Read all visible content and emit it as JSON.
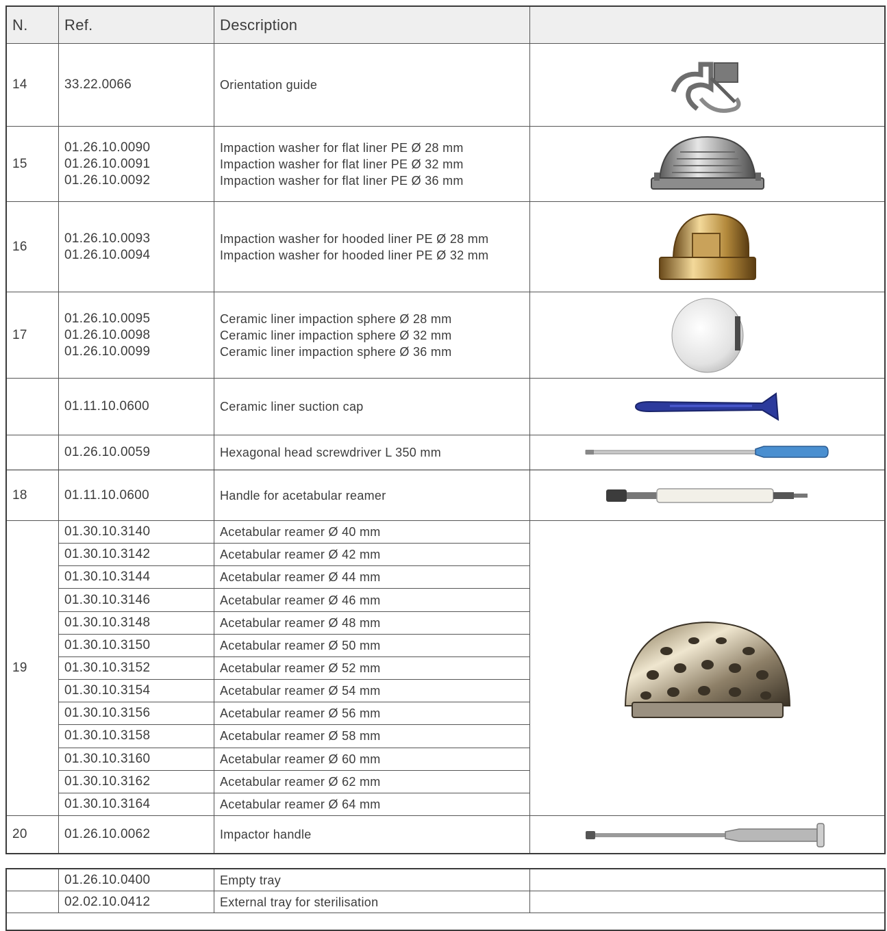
{
  "header": {
    "n": "N.",
    "ref": "Ref.",
    "description": "Description",
    "image": ""
  },
  "rows": [
    {
      "n": "14",
      "refs": [
        "33.22.0066"
      ],
      "descs": [
        "Orientation guide"
      ],
      "image": "orientation-guide-image"
    },
    {
      "n": "15",
      "refs": [
        "01.26.10.0090",
        "01.26.10.0091",
        "01.26.10.0092"
      ],
      "descs": [
        "Impaction washer for flat liner PE Ø 28 mm",
        "Impaction washer for flat liner PE Ø 32 mm",
        "Impaction washer for flat liner PE Ø 36 mm"
      ],
      "image": "flat-liner-washer-image"
    },
    {
      "n": "16",
      "refs": [
        "01.26.10.0093",
        "01.26.10.0094"
      ],
      "descs": [
        "Impaction washer for hooded liner PE Ø 28 mm",
        "Impaction washer for hooded liner PE Ø 32 mm"
      ],
      "image": "hooded-liner-washer-image"
    },
    {
      "n": "17",
      "refs": [
        "01.26.10.0095",
        "01.26.10.0098",
        "01.26.10.0099"
      ],
      "descs": [
        "Ceramic liner impaction sphere Ø 28 mm",
        "Ceramic liner impaction sphere Ø 32 mm",
        "Ceramic liner impaction sphere Ø 36 mm"
      ],
      "image": "ceramic-sphere-image"
    },
    {
      "n": "",
      "refs": [
        "01.11.10.0600"
      ],
      "descs": [
        "Ceramic liner suction cap"
      ],
      "image": "suction-cap-image"
    },
    {
      "n": "",
      "refs": [
        "01.26.10.0059"
      ],
      "descs": [
        "Hexagonal head screwdriver L 350 mm"
      ],
      "image": "screwdriver-image"
    },
    {
      "n": "18",
      "refs": [
        "01.11.10.0600"
      ],
      "descs": [
        "Handle for acetabular reamer"
      ],
      "image": "reamer-handle-image"
    }
  ],
  "reamers": {
    "n": "19",
    "image": "acetabular-reamer-image",
    "items": [
      {
        "ref": "01.30.10.3140",
        "desc": "Acetabular reamer Ø 40 mm"
      },
      {
        "ref": "01.30.10.3142",
        "desc": "Acetabular reamer Ø 42 mm"
      },
      {
        "ref": "01.30.10.3144",
        "desc": "Acetabular reamer Ø 44 mm"
      },
      {
        "ref": "01.30.10.3146",
        "desc": "Acetabular reamer Ø 46 mm"
      },
      {
        "ref": "01.30.10.3148",
        "desc": "Acetabular reamer Ø 48 mm"
      },
      {
        "ref": "01.30.10.3150",
        "desc": "Acetabular reamer Ø 50 mm"
      },
      {
        "ref": "01.30.10.3152",
        "desc": "Acetabular reamer Ø 52 mm"
      },
      {
        "ref": "01.30.10.3154",
        "desc": "Acetabular reamer Ø 54 mm"
      },
      {
        "ref": "01.30.10.3156",
        "desc": "Acetabular reamer Ø 56 mm"
      },
      {
        "ref": "01.30.10.3158",
        "desc": "Acetabular reamer Ø 58 mm"
      },
      {
        "ref": "01.30.10.3160",
        "desc": "Acetabular reamer Ø 60 mm"
      },
      {
        "ref": "01.30.10.3162",
        "desc": "Acetabular reamer Ø 62 mm"
      },
      {
        "ref": "01.30.10.3164",
        "desc": "Acetabular reamer Ø 64 mm"
      }
    ]
  },
  "impactor": {
    "n": "20",
    "ref": "01.26.10.0062",
    "desc": "Impactor handle",
    "image": "impactor-handle-image"
  },
  "tray": [
    {
      "n": "",
      "ref": "01.26.10.0400",
      "desc": "Empty tray"
    },
    {
      "n": "",
      "ref": "02.02.10.0412",
      "desc": "External tray for sterilisation"
    }
  ]
}
